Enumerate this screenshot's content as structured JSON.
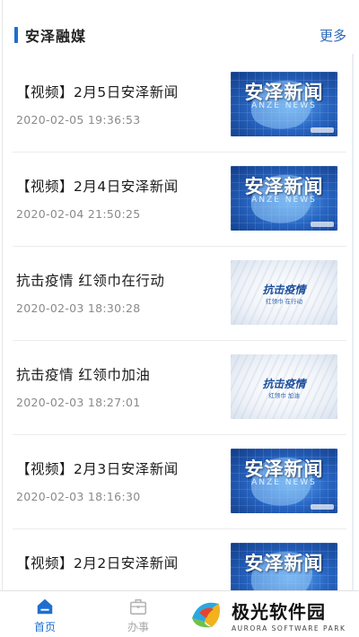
{
  "section": {
    "title": "安泽融媒",
    "more_label": "更多"
  },
  "news": [
    {
      "title": "【视频】2月5日安泽新闻",
      "time": "2020-02-05 19:36:53",
      "thumb": {
        "kind": "news",
        "brand_cn": "安泽新闻",
        "brand_en": "ANZE NEWS"
      }
    },
    {
      "title": "【视频】2月4日安泽新闻",
      "time": "2020-02-04 21:50:25",
      "thumb": {
        "kind": "news",
        "brand_cn": "安泽新闻",
        "brand_en": "ANZE NEWS"
      }
    },
    {
      "title": "抗击疫情 红领巾在行动",
      "time": "2020-02-03 18:30:28",
      "thumb": {
        "kind": "epidemic",
        "caption_main": "抗击疫情",
        "caption_sub": "红领巾 在行动"
      }
    },
    {
      "title": "抗击疫情 红领巾加油",
      "time": "2020-02-03 18:27:01",
      "thumb": {
        "kind": "epidemic",
        "caption_main": "抗击疫情",
        "caption_sub": "红领巾 加油"
      }
    },
    {
      "title": "【视频】2月3日安泽新闻",
      "time": "2020-02-03 18:16:30",
      "thumb": {
        "kind": "news",
        "brand_cn": "安泽新闻",
        "brand_en": "ANZE NEWS"
      }
    },
    {
      "title": "【视频】2月2日安泽新闻",
      "time": "",
      "thumb": {
        "kind": "news",
        "brand_cn": "安泽新闻",
        "brand_en": ""
      }
    }
  ],
  "tabbar": {
    "home_label": "首页",
    "service_label": "办事",
    "home_icon": "home-icon",
    "service_icon": "briefcase-icon"
  },
  "watermark": {
    "name_cn": "极光软件园",
    "name_en": "AURORA SOFTWARE PARK"
  },
  "colors": {
    "accent": "#1e6fd0",
    "more_link": "#2a67b8",
    "time_text": "#8a8a8a"
  }
}
